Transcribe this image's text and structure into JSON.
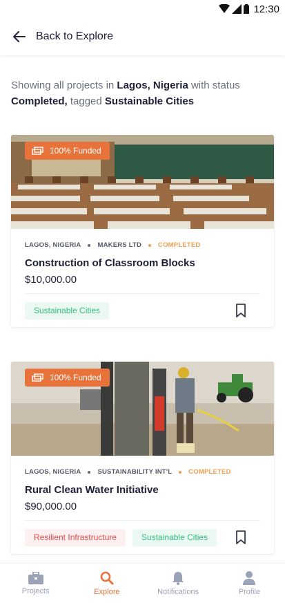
{
  "status_bar": {
    "time": "12:30"
  },
  "header": {
    "back_label": "Back to Explore"
  },
  "summary": {
    "prefix": "Showing all projects in ",
    "location": "Lagos, Nigeria",
    "mid": " with status ",
    "status": "Completed,",
    "tagged": " tagged ",
    "tag": "Sustainable Cities"
  },
  "projects": [
    {
      "badge": "100% Funded",
      "location": "LAGOS, NIGERIA",
      "organization": "MAKERS LTD",
      "status": "COMPLETED",
      "title": "Construction of Classroom Blocks",
      "amount": "$10,000.00",
      "tags": [
        "Sustainable Cities"
      ]
    },
    {
      "badge": "100% Funded",
      "location": "LAGOS, NIGERIA",
      "organization": "SUSTAINABILITY INT'L",
      "status": "COMPLETED",
      "title": "Rural Clean Water Initiative",
      "amount": "$90,000.00",
      "tags": [
        "Resilient Infrastructure",
        "Sustainable Cities"
      ]
    }
  ],
  "nav": [
    {
      "label": "Projects",
      "icon": "briefcase-icon"
    },
    {
      "label": "Explore",
      "icon": "search-icon",
      "active": true
    },
    {
      "label": "Notifications",
      "icon": "bell-icon"
    },
    {
      "label": "Profile",
      "icon": "person-icon"
    }
  ],
  "colors": {
    "accent": "#e8733a",
    "status": "#f0a050",
    "tag_green": "#2fbf7e",
    "tag_red": "#e04a4a"
  }
}
